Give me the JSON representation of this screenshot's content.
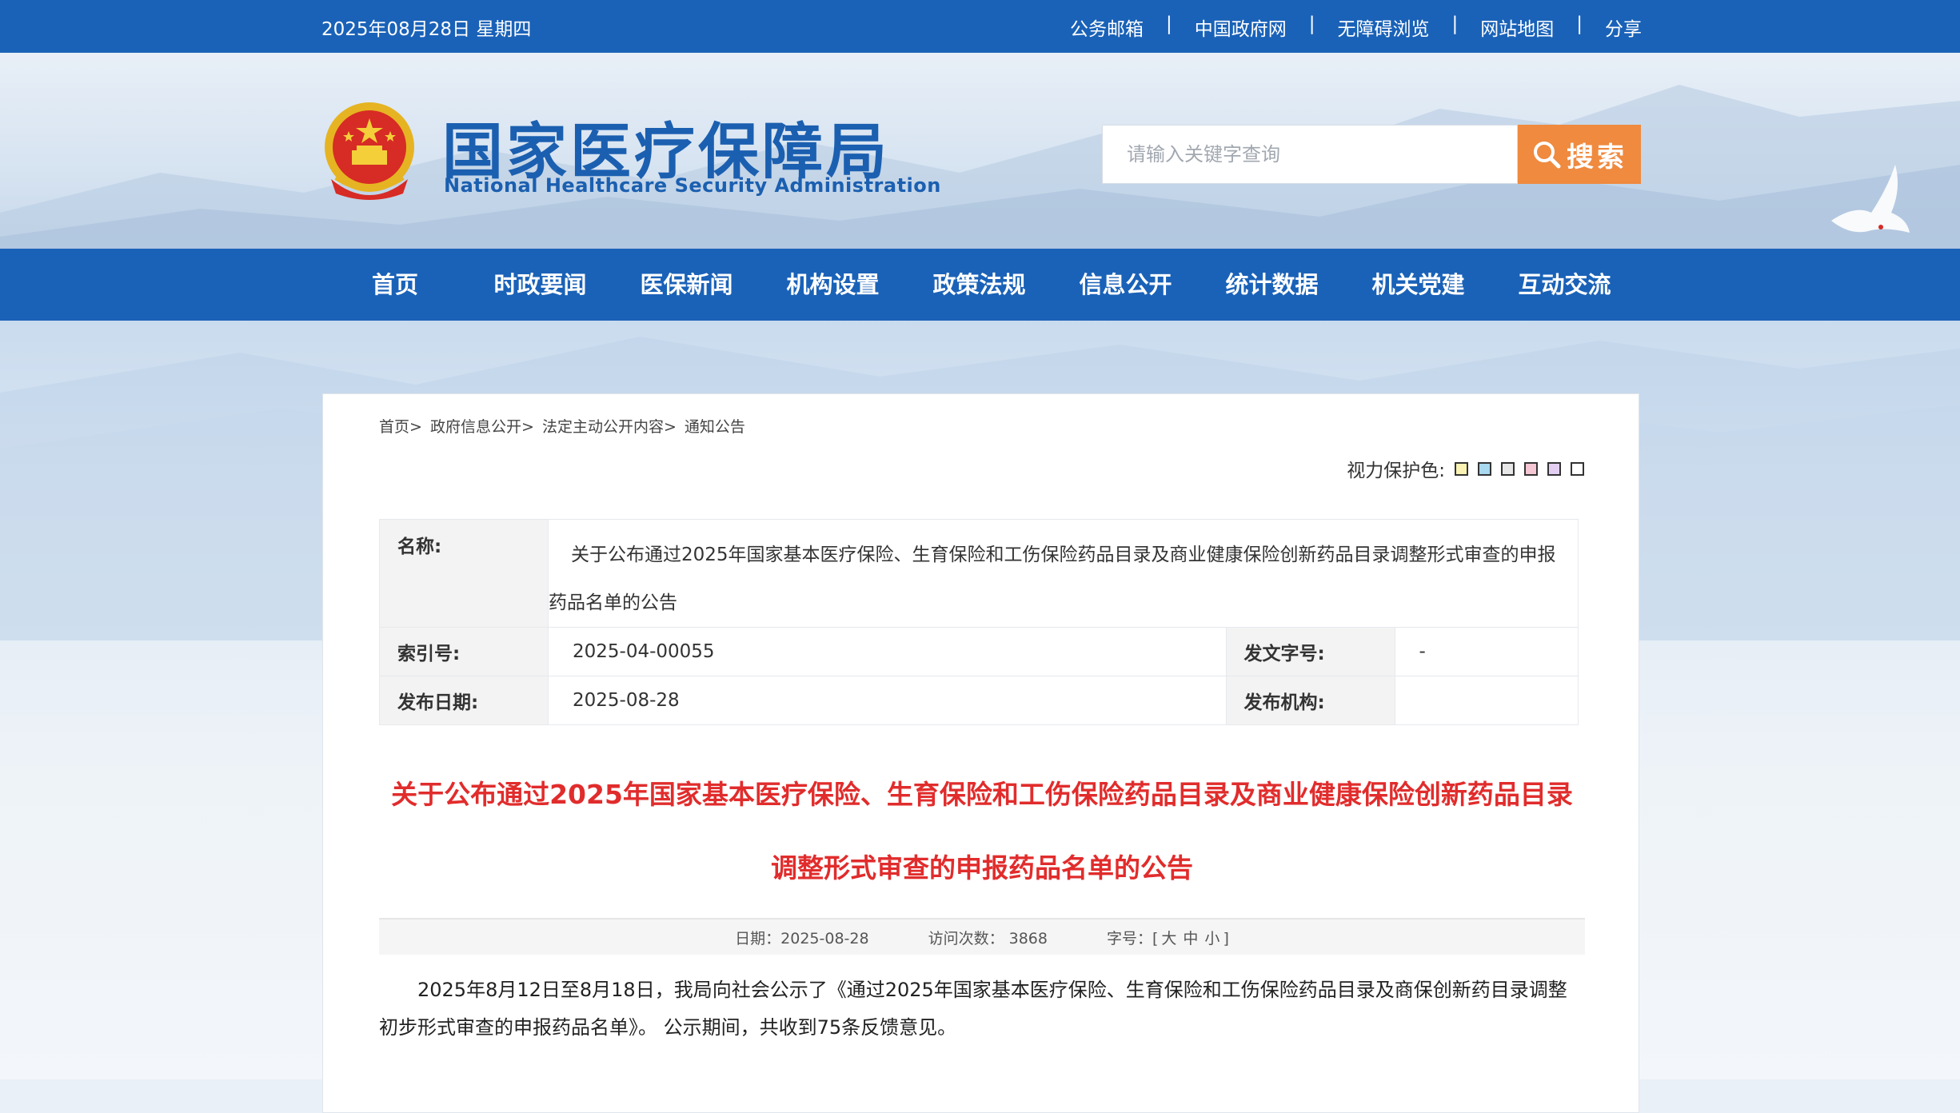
{
  "topbar": {
    "date": "2025年08月28日 星期四",
    "links": [
      "公务邮箱",
      "中国政府网",
      "无障碍浏览",
      "网站地图",
      "分享"
    ],
    "separator": "|"
  },
  "header": {
    "logo_cn": "国家医疗保障局",
    "logo_en": "National Healthcare Security Administration",
    "search_placeholder": "请输入关键字查询",
    "search_button": "搜索"
  },
  "nav": [
    "首页",
    "时政要闻",
    "医保新闻",
    "机构设置",
    "政策法规",
    "信息公开",
    "统计数据",
    "机关党建",
    "互动交流"
  ],
  "breadcrumb": [
    "首页>",
    "政府信息公开>",
    "法定主动公开内容>",
    "通知公告"
  ],
  "eye_protection": {
    "label": "视力保护色:",
    "colors": [
      "#fbf3b4",
      "#a9d8f0",
      "#e7e7e7",
      "#f5c6d3",
      "#e3cff1",
      "#ffffff"
    ]
  },
  "meta": {
    "name_label": "名称:",
    "name_value": "关于公布通过2025年国家基本医疗保险、生育保险和工伤保险药品目录及商业健康保险创新药品目录调整形式审查的申报药品名单的公告",
    "index_label": "索引号:",
    "index_value": "2025-04-00055",
    "docno_label": "发文字号:",
    "docno_value": "-",
    "date_label": "发布日期:",
    "date_value": "2025-08-28",
    "org_label": "发布机构:",
    "org_value": ""
  },
  "article": {
    "title_line1": "关于公布通过2025年国家基本医疗保险、生育保险和工伤保险药品目录及商业健康保险创新药品目录",
    "title_line2": "调整形式审查的申报药品名单的公告",
    "date": "日期：2025-08-28",
    "views": "访问次数： 3868",
    "fontsize_label": "字号：[",
    "size_large": "大",
    "size_medium": "中",
    "size_small": "小",
    "fontsize_close": "]",
    "body": "2025年8月12日至8月18日，我局向社会公示了《通过2025年国家基本医疗保险、生育保险和工伤保险药品目录及商保创新药目录调整初步形式审查的申报药品名单》。 公示期间，共收到75条反馈意见。"
  },
  "colors": {
    "brand_blue": "#1a62b8",
    "search_orange": "#ef8a3f",
    "title_red": "#e12c2c"
  }
}
